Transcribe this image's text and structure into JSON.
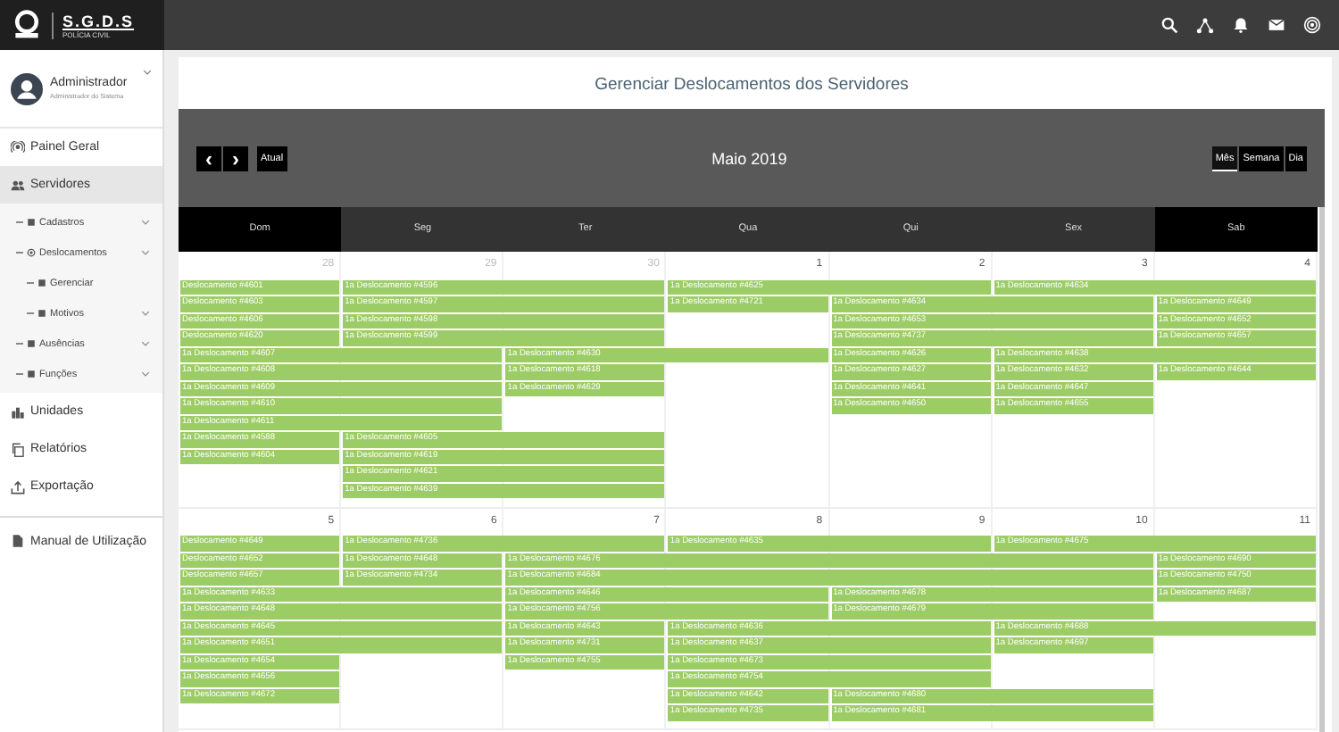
{
  "brand": {
    "title": "S.G.D.S",
    "subtitle": "POLÍCIA CIVIL"
  },
  "user": {
    "name": "Administrador",
    "role": "Administrador do Sistema"
  },
  "sidebar": {
    "items": [
      {
        "label": "Painel Geral",
        "selected": false
      },
      {
        "label": "Servidores",
        "selected": true,
        "children": [
          {
            "label": "Cadastros",
            "expandable": true
          },
          {
            "label": "Deslocamentos",
            "expandable": true,
            "expanded": true,
            "children": [
              {
                "label": "Gerenciar",
                "expandable": false
              },
              {
                "label": "Motivos",
                "expandable": true
              }
            ]
          },
          {
            "label": "Ausências",
            "expandable": true
          },
          {
            "label": "Funções",
            "expandable": true
          }
        ]
      },
      {
        "label": "Unidades",
        "selected": false
      },
      {
        "label": "Relatórios",
        "selected": false
      },
      {
        "label": "Exportação",
        "selected": false
      }
    ],
    "footer_item": {
      "label": "Manual de Utilização"
    }
  },
  "page": {
    "title": "Gerenciar Deslocamentos dos Servidores"
  },
  "calendar": {
    "prev": "‹",
    "next": "›",
    "today": "Atual",
    "month": "Maio 2019",
    "views": [
      {
        "label": "Mês",
        "selected": true
      },
      {
        "label": "Semana",
        "selected": false
      },
      {
        "label": "Dia",
        "selected": false
      }
    ],
    "weekdays": [
      {
        "label": "Dom",
        "weekend": true
      },
      {
        "label": "Seg",
        "weekend": false
      },
      {
        "label": "Ter",
        "weekend": false
      },
      {
        "label": "Qua",
        "weekend": false
      },
      {
        "label": "Qui",
        "weekend": false
      },
      {
        "label": "Sex",
        "weekend": false
      },
      {
        "label": "Sab",
        "weekend": true
      }
    ],
    "weeks": [
      {
        "days": [
          {
            "label": "28",
            "other_month": true
          },
          {
            "label": "29",
            "other_month": true
          },
          {
            "label": "30",
            "other_month": true
          },
          {
            "label": "1",
            "other_month": false
          },
          {
            "label": "2",
            "other_month": false
          },
          {
            "label": "3",
            "other_month": false
          },
          {
            "label": "4",
            "other_month": false
          }
        ],
        "lanes": [
          [
            {
              "kind": "event",
              "title": "Deslocamento #4601"
            },
            {
              "kind": "event",
              "title": "1a Deslocamento #4596"
            },
            {
              "kind": "cont"
            },
            {
              "kind": "event",
              "title": "1a Deslocamento #4625"
            },
            {
              "kind": "cont"
            },
            {
              "kind": "event",
              "title": "1a Deslocamento #4634"
            },
            {
              "kind": "cont"
            }
          ],
          [
            {
              "kind": "event",
              "title": "Deslocamento #4603"
            },
            {
              "kind": "event",
              "title": "1a Deslocamento #4597"
            },
            {
              "kind": "cont"
            },
            {
              "kind": "event",
              "title": "1a Deslocamento #4721"
            },
            {
              "kind": "event",
              "title": "1a Deslocamento #4634"
            },
            {
              "kind": "cont"
            },
            {
              "kind": "event",
              "title": "1a Deslocamento #4649"
            }
          ],
          [
            {
              "kind": "event",
              "title": "Deslocamento #4606"
            },
            {
              "kind": "event",
              "title": "1a Deslocamento #4598"
            },
            {
              "kind": "cont"
            },
            {
              "kind": "empty"
            },
            {
              "kind": "event",
              "title": "1a Deslocamento #4653"
            },
            {
              "kind": "cont"
            },
            {
              "kind": "event",
              "title": "1a Deslocamento #4652"
            }
          ],
          [
            {
              "kind": "event",
              "title": "Deslocamento #4620"
            },
            {
              "kind": "event",
              "title": "1a Deslocamento #4599"
            },
            {
              "kind": "cont"
            },
            {
              "kind": "empty"
            },
            {
              "kind": "event",
              "title": "1a Deslocamento #4737"
            },
            {
              "kind": "cont"
            },
            {
              "kind": "event",
              "title": "1a Deslocamento #4657"
            }
          ],
          [
            {
              "kind": "event",
              "title": "1a Deslocamento #4607"
            },
            {
              "kind": "cont"
            },
            {
              "kind": "event",
              "title": "1a Deslocamento #4630"
            },
            {
              "kind": "cont"
            },
            {
              "kind": "event",
              "title": "1a Deslocamento #4626"
            },
            {
              "kind": "event",
              "title": "1a Deslocamento #4638"
            },
            {
              "kind": "cont"
            }
          ],
          [
            {
              "kind": "event",
              "title": "1a Deslocamento #4608"
            },
            {
              "kind": "cont"
            },
            {
              "kind": "event",
              "title": "1a Deslocamento #4618"
            },
            {
              "kind": "empty"
            },
            {
              "kind": "event",
              "title": "1a Deslocamento #4627"
            },
            {
              "kind": "event",
              "title": "1a Deslocamento #4632"
            },
            {
              "kind": "event",
              "title": "1a Deslocamento #4644"
            }
          ],
          [
            {
              "kind": "event",
              "title": "1a Deslocamento #4609"
            },
            {
              "kind": "cont"
            },
            {
              "kind": "event",
              "title": "1a Deslocamento #4629"
            },
            {
              "kind": "empty"
            },
            {
              "kind": "event",
              "title": "1a Deslocamento #4641"
            },
            {
              "kind": "event",
              "title": "1a Deslocamento #4647"
            }
          ],
          [
            {
              "kind": "event",
              "title": "1a Deslocamento #4610"
            },
            {
              "kind": "cont"
            },
            {
              "kind": "empty"
            },
            {
              "kind": "empty"
            },
            {
              "kind": "event",
              "title": "1a Deslocamento #4650"
            },
            {
              "kind": "event",
              "title": "1a Deslocamento #4655"
            }
          ],
          [
            {
              "kind": "event",
              "title": "1a Deslocamento #4611"
            },
            {
              "kind": "cont"
            }
          ],
          [
            {
              "kind": "event",
              "title": "1a Deslocamento #4588"
            },
            {
              "kind": "event",
              "title": "1a Deslocamento #4605"
            },
            {
              "kind": "cont"
            }
          ],
          [
            {
              "kind": "event",
              "title": "1a Deslocamento #4604"
            },
            {
              "kind": "event",
              "title": "1a Deslocamento #4619"
            },
            {
              "kind": "cont"
            }
          ],
          [
            {
              "kind": "empty"
            },
            {
              "kind": "event",
              "title": "1a Deslocamento #4621"
            },
            {
              "kind": "cont"
            }
          ],
          [
            {
              "kind": "empty"
            },
            {
              "kind": "event",
              "title": "1a Deslocamento #4639"
            },
            {
              "kind": "cont"
            }
          ]
        ]
      },
      {
        "days": [
          {
            "label": "5",
            "other_month": false
          },
          {
            "label": "6",
            "other_month": false
          },
          {
            "label": "7",
            "other_month": false
          },
          {
            "label": "8",
            "other_month": false
          },
          {
            "label": "9",
            "other_month": false
          },
          {
            "label": "10",
            "other_month": false
          },
          {
            "label": "11",
            "other_month": false
          }
        ],
        "lanes": [
          [
            {
              "kind": "event",
              "title": "Deslocamento #4649"
            },
            {
              "kind": "event",
              "title": "1a Deslocamento #4736"
            },
            {
              "kind": "cont"
            },
            {
              "kind": "event",
              "title": "1a Deslocamento #4635"
            },
            {
              "kind": "cont"
            },
            {
              "kind": "event",
              "title": "1a Deslocamento #4675"
            },
            {
              "kind": "cont"
            }
          ],
          [
            {
              "kind": "event",
              "title": "Deslocamento #4652"
            },
            {
              "kind": "event",
              "title": "1a Deslocamento #4648"
            },
            {
              "kind": "event",
              "title": "1a Deslocamento #4676"
            },
            {
              "kind": "cont"
            },
            {
              "kind": "cont"
            },
            {
              "kind": "cont"
            },
            {
              "kind": "event",
              "title": "1a Deslocamento #4690"
            }
          ],
          [
            {
              "kind": "event",
              "title": "Deslocamento #4657"
            },
            {
              "kind": "event",
              "title": "1a Deslocamento #4734"
            },
            {
              "kind": "event",
              "title": "1a Deslocamento #4684"
            },
            {
              "kind": "cont"
            },
            {
              "kind": "cont"
            },
            {
              "kind": "cont"
            },
            {
              "kind": "event",
              "title": "1a Deslocamento #4750"
            }
          ],
          [
            {
              "kind": "event",
              "title": "1a Deslocamento #4633"
            },
            {
              "kind": "cont"
            },
            {
              "kind": "event",
              "title": "1a Deslocamento #4646"
            },
            {
              "kind": "cont"
            },
            {
              "kind": "event",
              "title": "1a Deslocamento #4678"
            },
            {
              "kind": "cont"
            },
            {
              "kind": "event",
              "title": "1a Deslocamento #4687"
            }
          ],
          [
            {
              "kind": "event",
              "title": "1a Deslocamento #4648"
            },
            {
              "kind": "cont"
            },
            {
              "kind": "event",
              "title": "1a Deslocamento #4756"
            },
            {
              "kind": "cont"
            },
            {
              "kind": "event",
              "title": "1a Deslocamento #4679"
            },
            {
              "kind": "cont"
            }
          ],
          [
            {
              "kind": "event",
              "title": "1a Deslocamento #4645"
            },
            {
              "kind": "cont"
            },
            {
              "kind": "event",
              "title": "1a Deslocamento #4643"
            },
            {
              "kind": "event",
              "title": "1a Deslocamento #4636"
            },
            {
              "kind": "cont"
            },
            {
              "kind": "event",
              "title": "1a Deslocamento #4688"
            },
            {
              "kind": "cont"
            }
          ],
          [
            {
              "kind": "event",
              "title": "1a Deslocamento #4651"
            },
            {
              "kind": "cont"
            },
            {
              "kind": "event",
              "title": "1a Deslocamento #4731"
            },
            {
              "kind": "event",
              "title": "1a Deslocamento #4637"
            },
            {
              "kind": "cont"
            },
            {
              "kind": "event",
              "title": "1a Deslocamento #4697"
            }
          ],
          [
            {
              "kind": "event",
              "title": "1a Deslocamento #4654"
            },
            {
              "kind": "empty"
            },
            {
              "kind": "event",
              "title": "1a Deslocamento #4755"
            },
            {
              "kind": "event",
              "title": "1a Deslocamento #4673"
            },
            {
              "kind": "cont"
            }
          ],
          [
            {
              "kind": "event",
              "title": "1a Deslocamento #4656"
            },
            {
              "kind": "empty"
            },
            {
              "kind": "empty"
            },
            {
              "kind": "event",
              "title": "1a Deslocamento #4754"
            },
            {
              "kind": "cont"
            }
          ],
          [
            {
              "kind": "event",
              "title": "1a Deslocamento #4672"
            },
            {
              "kind": "empty"
            },
            {
              "kind": "empty"
            },
            {
              "kind": "event",
              "title": "1a Deslocamento #4642"
            },
            {
              "kind": "event",
              "title": "1a Deslocamento #4680"
            },
            {
              "kind": "cont"
            }
          ],
          [
            {
              "kind": "empty"
            },
            {
              "kind": "empty"
            },
            {
              "kind": "empty"
            },
            {
              "kind": "event",
              "title": "1a Deslocamento #4735"
            },
            {
              "kind": "event",
              "title": "1a Deslocamento #4681"
            },
            {
              "kind": "cont"
            }
          ]
        ]
      }
    ]
  }
}
